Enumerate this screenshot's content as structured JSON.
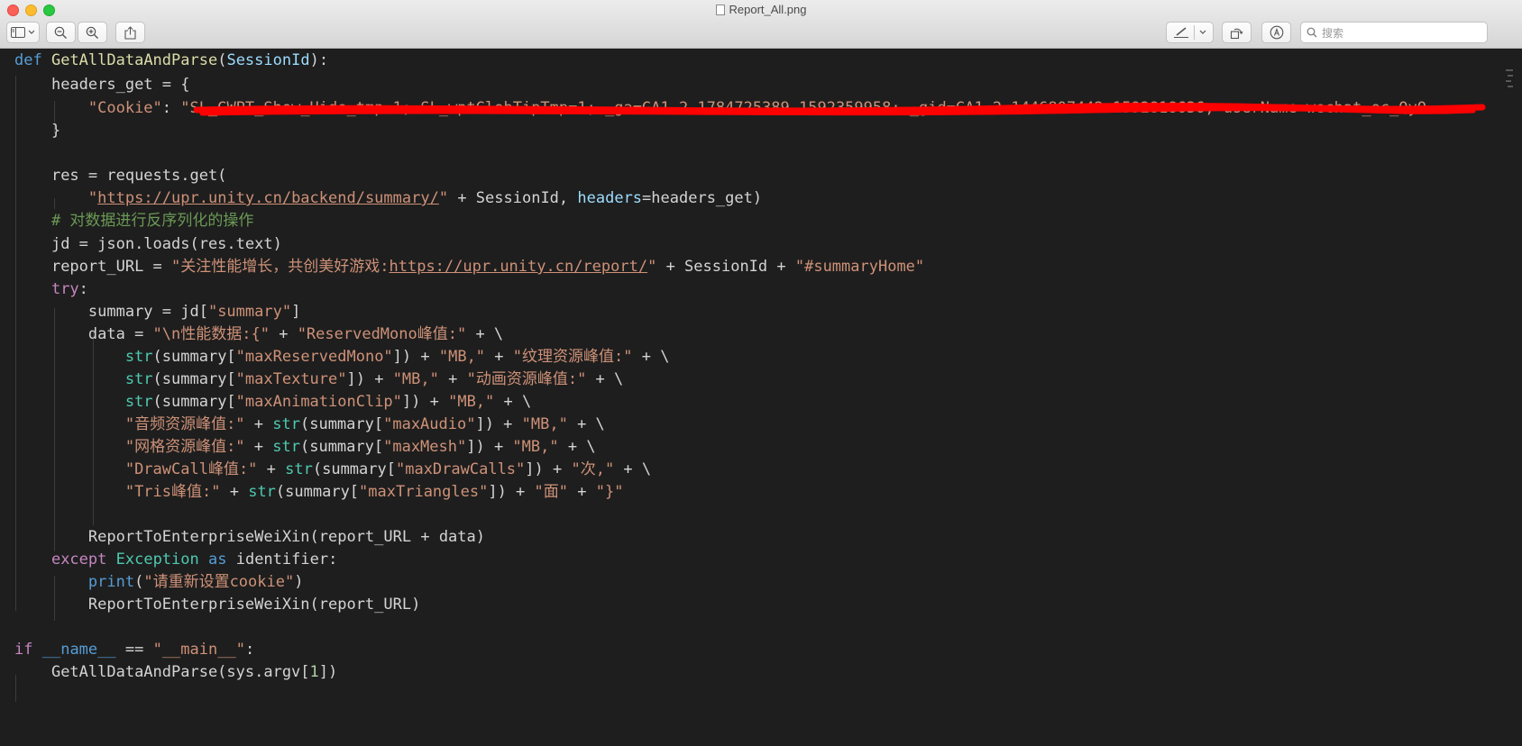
{
  "window": {
    "title": "Report_All.png"
  },
  "toolbar": {
    "search_placeholder": "搜索",
    "icons": [
      "sidebar-icon",
      "chevron-down-icon",
      "zoom-out-icon",
      "zoom-in-icon",
      "share-icon",
      "markup-pen-icon",
      "rotate-icon",
      "annotate-icon",
      "search-icon"
    ]
  },
  "colors": {
    "keyword": "#569cd6",
    "control": "#c586c0",
    "function": "#dcdcaa",
    "string": "#ce9178",
    "parameter": "#9cdcfe",
    "builtin": "#4ec9b0",
    "comment": "#6a9955",
    "redaction": "#ff0000"
  },
  "code": {
    "l1": {
      "kw": "def",
      "fn": "GetAllDataAndParse",
      "open": "(",
      "param": "SessionId",
      "close": "):"
    },
    "l2": "headers_get = {",
    "l3": {
      "key": "\"Cookie\"",
      "colon": ": ",
      "value": "\"SL_GWPT_Show_Hide_tmp=1; SL_wptGlobTipTmp=1; _ga=GA1.2.1784725389.1592359958; _gid=GA1.2.1446807442.1592818636; userName=wechat_oc_QyO"
    },
    "l4": "}",
    "l6": "res = requests.get(",
    "l7": {
      "q1": "\"",
      "url": "https://upr.unity.cn/backend/summary/",
      "q2": "\"",
      "mid": " + SessionId, ",
      "param": "headers",
      "rest": "=headers_get)"
    },
    "l8": "# 对数据进行反序列化的操作",
    "l9": "jd = json.loads(res.text)",
    "l10": {
      "pre": "report_URL = ",
      "s1": "\"关注性能增长，共创美好游戏:",
      "url": "https://upr.unity.cn/report/",
      "s2": "\"",
      "mid": " + SessionId + ",
      "s3": "\"#summaryHome\""
    },
    "l11": "try",
    "l11b": ":",
    "l12": {
      "pre": "summary = jd[",
      "s": "\"summary\"",
      "post": "]"
    },
    "l13": {
      "pre": "data = ",
      "s1": "\"\\n性能数据:{\"",
      "op": " + ",
      "s2": "\"ReservedMono峰值:\"",
      "post": " + \\"
    },
    "l14": {
      "bi": "str",
      "a": "(summary[",
      "s1": "\"maxReservedMono\"",
      "b": "]) + ",
      "s2": "\"MB,\"",
      "c": " + ",
      "s3": "\"纹理资源峰值:\"",
      "d": " + \\"
    },
    "l15": {
      "bi": "str",
      "a": "(summary[",
      "s1": "\"maxTexture\"",
      "b": "]) + ",
      "s2": "\"MB,\"",
      "c": " + ",
      "s3": "\"动画资源峰值:\"",
      "d": " + \\"
    },
    "l16": {
      "bi": "str",
      "a": "(summary[",
      "s1": "\"maxAnimationClip\"",
      "b": "]) + ",
      "s2": "\"MB,\"",
      "d": " + \\"
    },
    "l17": {
      "s0": "\"音频资源峰值:\"",
      "op": " + ",
      "bi": "str",
      "a": "(summary[",
      "s1": "\"maxAudio\"",
      "b": "]) + ",
      "s2": "\"MB,\"",
      "d": " + \\"
    },
    "l18": {
      "s0": "\"网格资源峰值:\"",
      "op": " + ",
      "bi": "str",
      "a": "(summary[",
      "s1": "\"maxMesh\"",
      "b": "]) + ",
      "s2": "\"MB,\"",
      "d": " + \\"
    },
    "l19": {
      "s0": "\"DrawCall峰值:\"",
      "op": " + ",
      "bi": "str",
      "a": "(summary[",
      "s1": "\"maxDrawCalls\"",
      "b": "]) + ",
      "s2": "\"次,\"",
      "d": " + \\"
    },
    "l20": {
      "s0": "\"Tris峰值:\"",
      "op": " + ",
      "bi": "str",
      "a": "(summary[",
      "s1": "\"maxTriangles\"",
      "b": "]) + ",
      "s2": "\"面\"",
      "c": " + ",
      "s3": "\"}\""
    },
    "l22": "ReportToEnterpriseWeiXin(report_URL + data)",
    "l23": {
      "ctl": "except",
      "sp1": " ",
      "bi": "Exception",
      "sp2": " ",
      "kw": "as",
      "rest": " identifier:"
    },
    "l24": {
      "kw": "print",
      "a": "(",
      "s": "\"请重新设置cookie\"",
      "b": ")"
    },
    "l25": "ReportToEnterpriseWeiXin(report_URL)",
    "l27": {
      "ctl": "if",
      "sp": " ",
      "kw": "__name__",
      "op": " == ",
      "s": "\"__main__\"",
      "post": ":"
    },
    "l28": {
      "pre": "GetAllDataAndParse(sys.argv[",
      "num": "1",
      "post": "])"
    }
  }
}
